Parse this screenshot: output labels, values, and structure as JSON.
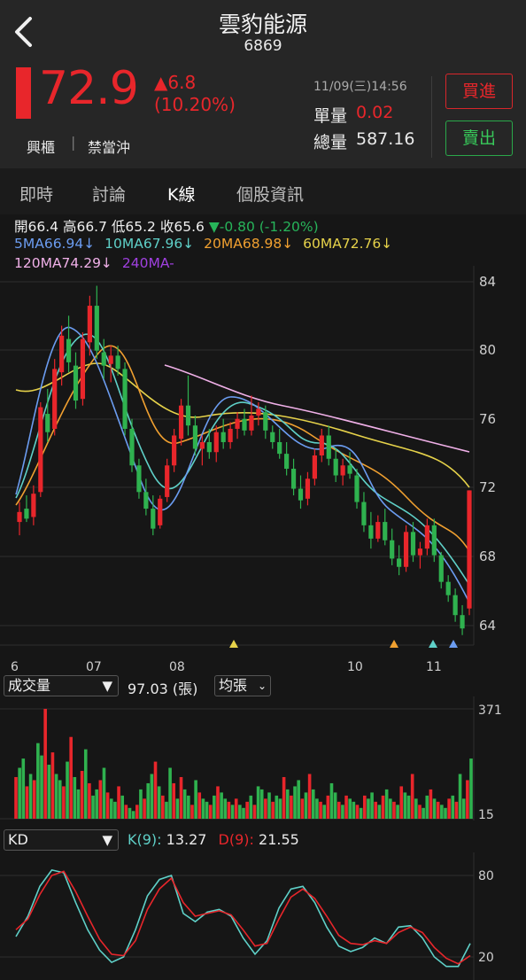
{
  "header": {
    "name": "雲豹能源",
    "code": "6869",
    "price": "72.9",
    "change": "▲6.8",
    "change_pct": "(10.20%)",
    "tags": [
      "興櫃",
      "禁當沖"
    ],
    "datetime": "11/09(三)14:56",
    "unit_vol_label": "單量",
    "unit_vol": "0.02",
    "total_vol_label": "總量",
    "total_vol": "587.16",
    "buy_label": "買進",
    "sell_label": "賣出"
  },
  "tabs": [
    {
      "label": "即時",
      "active": false
    },
    {
      "label": "討論",
      "active": false
    },
    {
      "label": "K線",
      "active": true
    },
    {
      "label": "個股資訊",
      "active": false
    }
  ],
  "ohlc": {
    "open": "開66.4",
    "high": "高66.7",
    "low": "低65.2",
    "close": "收65.6",
    "change": "▼-0.80 (-1.20%)"
  },
  "ma": {
    "ma5": "5MA66.94↓",
    "ma10": "10MA67.96↓",
    "ma20": "20MA68.98↓",
    "ma60": "60MA72.76↓",
    "ma120": "120MA74.29↓",
    "ma240": "240MA-"
  },
  "colors": {
    "up": "#e8262b",
    "down": "#2fb24f",
    "ma5": "#6b9cf0",
    "ma10": "#5fd0c8",
    "ma20": "#f0a030",
    "ma60": "#e6d24a",
    "ma120": "#f0b0e8",
    "ma240": "#a040e0"
  },
  "volume_panel": {
    "selector": "成交量",
    "value": "97.03 (張)",
    "mode": "均張"
  },
  "kd_panel": {
    "selector": "KD",
    "k_label": "K(9):",
    "k_value": "13.27",
    "d_label": "D(9):",
    "d_value": "21.55"
  },
  "chart_data": [
    {
      "type": "candlestick",
      "title": "",
      "x_tick_labels": [
        "6",
        "07",
        "08",
        "10",
        "11"
      ],
      "y_tick_labels": [
        "84",
        "80",
        "76",
        "72",
        "68",
        "64"
      ],
      "ylim": [
        63.6,
        86.4
      ],
      "ohlc": [
        [
          71,
          72.2,
          70.2,
          71.6
        ],
        [
          71.8,
          72.6,
          71,
          71.2
        ],
        [
          71.3,
          73.2,
          70.8,
          72.7
        ],
        [
          72.8,
          78.2,
          72.5,
          77.9
        ],
        [
          77.5,
          79,
          75.8,
          76.4
        ],
        [
          76.6,
          80.8,
          76.2,
          80.2
        ],
        [
          80,
          82.8,
          79.2,
          82.2
        ],
        [
          82,
          83.4,
          80,
          80.6
        ],
        [
          80.4,
          81.2,
          77.8,
          78.3
        ],
        [
          78.4,
          82.4,
          78,
          82
        ],
        [
          81.8,
          84.6,
          81,
          84
        ],
        [
          84,
          85.2,
          80.8,
          81.3
        ],
        [
          81.2,
          82,
          79.6,
          80.4
        ],
        [
          80.5,
          81.6,
          79.4,
          81
        ],
        [
          81,
          81.6,
          79.8,
          80.2
        ],
        [
          80.2,
          80.6,
          76.2,
          76.6
        ],
        [
          76.6,
          77.2,
          74,
          74.4
        ],
        [
          74.4,
          74.8,
          72.4,
          72.8
        ],
        [
          72.8,
          73.6,
          71.4,
          71.8
        ],
        [
          71.8,
          72.6,
          70.2,
          70.6
        ],
        [
          70.8,
          72.6,
          70.6,
          72.4
        ],
        [
          72.5,
          74.8,
          72.2,
          74.4
        ],
        [
          74.4,
          76.6,
          74,
          76.2
        ],
        [
          76,
          78.4,
          75.6,
          78
        ],
        [
          78,
          79.8,
          76.2,
          76.8
        ],
        [
          76.8,
          77.4,
          75,
          75.4
        ],
        [
          75.4,
          76.2,
          74.4,
          75.8
        ],
        [
          75.8,
          76.6,
          74.8,
          75.2
        ],
        [
          75.2,
          76.8,
          74.6,
          76.4
        ],
        [
          76.4,
          77.2,
          75.4,
          75.8
        ],
        [
          75.8,
          77,
          75.4,
          76.6
        ],
        [
          76.6,
          77.6,
          76,
          77.2
        ],
        [
          77.2,
          77.8,
          76.2,
          76.5
        ],
        [
          76.5,
          78.6,
          76.2,
          77.4
        ],
        [
          77.4,
          78.2,
          76.8,
          77.8
        ],
        [
          77.6,
          78,
          76,
          76.5
        ],
        [
          76.4,
          76.8,
          75.4,
          75.8
        ],
        [
          75.8,
          76.6,
          74.8,
          75.1
        ],
        [
          75.1,
          75.8,
          73.8,
          74.2
        ],
        [
          74.2,
          74.8,
          72.6,
          73
        ],
        [
          73,
          73.8,
          71.8,
          72.3
        ],
        [
          72.4,
          74,
          72,
          73.6
        ],
        [
          73.6,
          75.4,
          73.2,
          75
        ],
        [
          75,
          76.6,
          74.6,
          76.2
        ],
        [
          76.2,
          76.8,
          74.4,
          74.8
        ],
        [
          74.8,
          75.4,
          73.4,
          73.8
        ],
        [
          73.8,
          74.8,
          73.2,
          74.4
        ],
        [
          74.4,
          75.2,
          73.6,
          73.9
        ],
        [
          73.8,
          74.2,
          71.8,
          72.2
        ],
        [
          72.2,
          72.8,
          70.4,
          70.8
        ],
        [
          70.8,
          71.6,
          69.4,
          70
        ],
        [
          70,
          71.4,
          69.8,
          71
        ],
        [
          71,
          71.8,
          69.6,
          69.9
        ],
        [
          69.9,
          70.6,
          68.4,
          68.8
        ],
        [
          68.8,
          69.6,
          67.8,
          68.3
        ],
        [
          68.3,
          70.8,
          68,
          70.4
        ],
        [
          70.4,
          71,
          68.6,
          69
        ],
        [
          69,
          69.8,
          68.2,
          69.4
        ],
        [
          69.4,
          71.2,
          69,
          70.8
        ],
        [
          70.8,
          71.2,
          68.6,
          69
        ],
        [
          69,
          69.2,
          67,
          67.4
        ],
        [
          67.4,
          67.8,
          66.2,
          66.6
        ],
        [
          66.6,
          67,
          65,
          65.4
        ],
        [
          65.4,
          66,
          64.2,
          64.6
        ],
        [
          65.8,
          72.9,
          65.4,
          72.9
        ]
      ]
    },
    {
      "type": "bar",
      "title": "成交量",
      "ylim": [
        15,
        371
      ],
      "y_tick_labels": [
        "371",
        "15"
      ],
      "values": [
        150,
        180,
        210,
        120,
        160,
        140,
        260,
        220,
        371,
        190,
        230,
        160,
        140,
        120,
        200,
        280,
        150,
        110,
        170,
        240,
        130,
        90,
        110,
        140,
        180,
        100,
        80,
        70,
        120,
        90,
        60,
        50,
        40,
        60,
        110,
        80,
        130,
        160,
        200,
        120,
        90,
        70,
        180,
        130,
        80,
        150,
        110,
        90,
        60,
        140,
        100,
        80,
        70,
        60,
        90,
        120,
        100,
        80,
        70,
        60,
        80,
        60,
        50,
        70,
        90,
        60,
        120,
        110,
        80,
        100,
        70,
        90,
        80,
        150,
        110,
        90,
        120,
        140,
        80,
        100,
        160,
        110,
        80,
        70,
        60,
        90,
        130,
        100,
        70,
        60,
        90,
        80,
        70,
        60,
        50,
        90,
        80,
        100,
        70,
        60,
        90,
        110,
        80,
        70,
        60,
        120,
        100,
        90,
        160,
        80,
        60,
        50,
        90,
        110,
        80,
        70,
        60,
        50,
        80,
        90,
        70,
        160,
        80,
        140,
        210
      ]
    },
    {
      "type": "line",
      "title": "KD",
      "ylim": [
        10,
        90
      ],
      "y_tick_labels": [
        "80",
        "20"
      ],
      "series": [
        {
          "name": "K(9)",
          "values": [
            35,
            50,
            72,
            84,
            82,
            60,
            40,
            25,
            16,
            20,
            40,
            65,
            77,
            80,
            52,
            46,
            53,
            55,
            50,
            34,
            22,
            32,
            56,
            70,
            72,
            60,
            42,
            28,
            24,
            27,
            34,
            30,
            42,
            43,
            34,
            20,
            13,
            13,
            30
          ]
        },
        {
          "name": "D(9)",
          "values": [
            40,
            48,
            66,
            80,
            83,
            68,
            50,
            33,
            22,
            21,
            32,
            55,
            70,
            78,
            60,
            50,
            52,
            54,
            51,
            40,
            28,
            30,
            48,
            64,
            70,
            63,
            50,
            36,
            30,
            29,
            32,
            30,
            38,
            42,
            38,
            27,
            19,
            15,
            21
          ]
        }
      ]
    }
  ]
}
